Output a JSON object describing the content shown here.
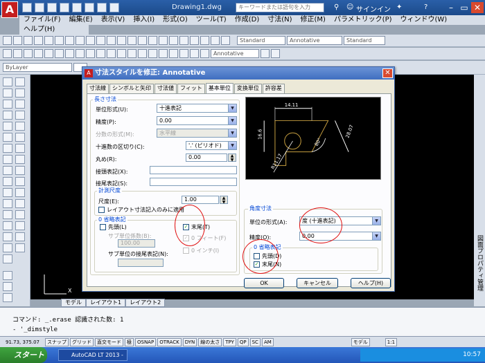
{
  "app": {
    "window_title": "Drawing1.dwg",
    "search_placeholder": "キーワードまたは語句を入力",
    "signin": "サインイン",
    "logo": "A"
  },
  "menu": [
    "ファイル(F)",
    "編集(E)",
    "表示(V)",
    "挿入(I)",
    "形式(O)",
    "ツール(T)",
    "作成(D)",
    "寸法(N)",
    "修正(M)",
    "パラメトリック(P)",
    "ウィンドウ(W)"
  ],
  "menu_row2": "ヘルプ(H)",
  "toolbar": {
    "layer_combo": "ByLayer",
    "style_standard": "Standard",
    "annotative": "Annotative",
    "standard2": "Standard"
  },
  "left_palette_label": "プロパティ",
  "right_palette_label": "図面プロパティ管理",
  "layout_tabs": [
    "モデル",
    "レイアウト1",
    "レイアウト2"
  ],
  "command_lines": [
    "コマンド: _.erase 認識された数: 1",
    "- '_dimstyle"
  ],
  "status": {
    "coords": "91.73, 375.07",
    "toggles": [
      "スナップ",
      "グリッド",
      "直交モード",
      "極",
      "OSNAP",
      "OTRACK",
      "DYN",
      "線の太さ",
      "TPY",
      "QP",
      "SC",
      "AM"
    ],
    "model": "モデル",
    "scale": "1:1"
  },
  "taskbar": {
    "start": "スタート",
    "app": "AutoCAD LT 2013 -",
    "clock": "10:57"
  },
  "dialog": {
    "title": "寸法スタイルを修正: Annotative",
    "tabs": [
      "寸法線",
      "シンボルと矢印",
      "寸法値",
      "フィット",
      "基本単位",
      "変換単位",
      "許容差"
    ],
    "active_tab": 4,
    "linear": {
      "group": "長さ寸法",
      "unit_format_label": "単位形式(U):",
      "unit_format_value": "十進表記",
      "precision_label": "精度(P):",
      "precision_value": "0.00",
      "fraction_label": "分数の形式(M):",
      "fraction_value": "水平線",
      "decimal_sep_label": "十進数の区切り(C):",
      "decimal_sep_value": "'.' (ピリオド)",
      "round_label": "丸め(R):",
      "round_value": "0.00",
      "prefix_label": "接頭表記(X):",
      "suffix_label": "接尾表記(S):",
      "measure_group": "計測尺度",
      "scale_label": "尺度(E):",
      "scale_value": "1.00",
      "layout_only_label": "レイアウト寸法記入のみに適用",
      "zero_group": "0 省略表記",
      "leading_label": "先頭(L)",
      "trailing_label": "末尾(T)",
      "subunit_factor_label": "サブ単位係数(B):",
      "subunit_factor_value": "100.00",
      "zero_feet_label": "0 フィート(F)",
      "zero_inches_label": "0 インチ(I)",
      "subunit_suffix_label": "サブ単位の接尾表記(N):"
    },
    "angular": {
      "group": "角度寸法",
      "unit_format_label": "単位の形式(A):",
      "unit_format_value": "度 (十進表記)",
      "precision_label": "精度(O):",
      "precision_value": "0.00",
      "zero_group": "0 省略表記",
      "leading_label": "先頭(D)",
      "trailing_label": "末尾(N)"
    },
    "preview": {
      "dim_top": "14.11",
      "dim_left": "16.6",
      "dim_right": "28.07",
      "dim_angle": "80°",
      "dim_radius": "R11.17"
    },
    "buttons": {
      "ok": "OK",
      "cancel": "キャンセル",
      "help": "ヘルプ(H)"
    }
  }
}
